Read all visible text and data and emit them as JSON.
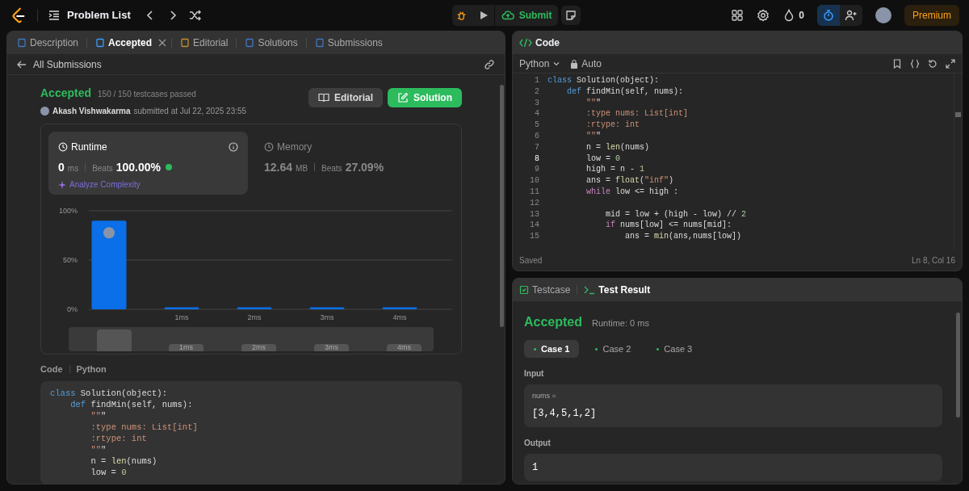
{
  "topbar": {
    "problem_list": "Problem List",
    "submit": "Submit",
    "streak": "0",
    "premium": "Premium"
  },
  "left_tabs": [
    {
      "label": "Description",
      "selected": false,
      "closable": false
    },
    {
      "label": "Accepted",
      "selected": true,
      "closable": true
    },
    {
      "label": "Editorial",
      "selected": false,
      "closable": false
    },
    {
      "label": "Solutions",
      "selected": false,
      "closable": false
    },
    {
      "label": "Submissions",
      "selected": false,
      "closable": false
    }
  ],
  "back_link": "All Submissions",
  "submission": {
    "status": "Accepted",
    "testcases": "150 / 150 testcases passed",
    "user": "Akash Vishwakarma",
    "submitted": "submitted at Jul 22, 2025 23:55",
    "editorial_button": "Editorial",
    "solution_button": "Solution"
  },
  "metrics": [
    {
      "title": "Runtime",
      "value": "0",
      "unit": "ms",
      "beats_label": "Beats",
      "beats": "100.00%",
      "analyze": "Analyze Complexity",
      "selected": true
    },
    {
      "title": "Memory",
      "value": "12.64",
      "unit": "MB",
      "beats_label": "Beats",
      "beats": "27.09%",
      "selected": false
    }
  ],
  "chart_data": {
    "type": "bar",
    "categories": [
      null,
      "1ms",
      "2ms",
      "3ms",
      "4ms"
    ],
    "values": [
      90,
      2,
      2,
      2,
      2
    ],
    "ylim": [
      0,
      100
    ],
    "yticks": [
      {
        "value": 0,
        "label": "0%"
      },
      {
        "value": 50,
        "label": "50%"
      },
      {
        "value": 100,
        "label": "100%"
      }
    ]
  },
  "overview_labels": [
    "1ms",
    "2ms",
    "3ms",
    "4ms"
  ],
  "code_section": {
    "label": "Code",
    "language": "Python",
    "lines": [
      "class Solution(object):",
      "    def findMin(self, nums):",
      "        \"\"\"",
      "        :type nums: List[int]",
      "        :rtype: int",
      "        \"\"\"",
      "        n = len(nums)",
      "        low = 0"
    ]
  },
  "editor": {
    "title": "Code",
    "language": "Python",
    "mode": "Auto",
    "status": "Saved",
    "position": "Ln 8, Col 16",
    "lines": [
      {
        "number": "1",
        "text": "class Solution(object):",
        "active": false
      },
      {
        "number": "2",
        "text": "    def findMin(self, nums):",
        "active": false
      },
      {
        "number": "3",
        "text": "        \"\"\"",
        "active": false
      },
      {
        "number": "4",
        "text": "        :type nums: List[int]",
        "active": false
      },
      {
        "number": "5",
        "text": "        :rtype: int",
        "active": false
      },
      {
        "number": "6",
        "text": "        \"\"\"",
        "active": false
      },
      {
        "number": "7",
        "text": "        n = len(nums)",
        "active": false
      },
      {
        "number": "8",
        "text": "        low = 0",
        "active": true
      },
      {
        "number": "9",
        "text": "        high = n - 1",
        "active": false
      },
      {
        "number": "10",
        "text": "        ans = float(\"inf\")",
        "active": false
      },
      {
        "number": "11",
        "text": "        while low <= high :",
        "active": false
      },
      {
        "number": "12",
        "active": false
      },
      {
        "number": "13",
        "text": "            mid = low + (high - low) // 2",
        "active": false
      },
      {
        "number": "14",
        "text": "            if nums[low] <= nums[mid]:",
        "active": false
      },
      {
        "number": "15",
        "text": "                ans = min(ans,nums[low])",
        "active": false
      }
    ]
  },
  "result": {
    "tabs": [
      {
        "label": "Testcase",
        "selected": false
      },
      {
        "label": "Test Result",
        "selected": true
      }
    ],
    "status": "Accepted",
    "runtime": "Runtime: 0 ms",
    "cases": [
      {
        "label": "Case 1",
        "selected": true
      },
      {
        "label": "Case 2",
        "selected": false
      },
      {
        "label": "Case 3",
        "selected": false
      }
    ],
    "input_label": "Input",
    "input_name": "nums =",
    "input_value": "[3,4,5,1,2]",
    "output_label": "Output",
    "output_value": "1"
  }
}
